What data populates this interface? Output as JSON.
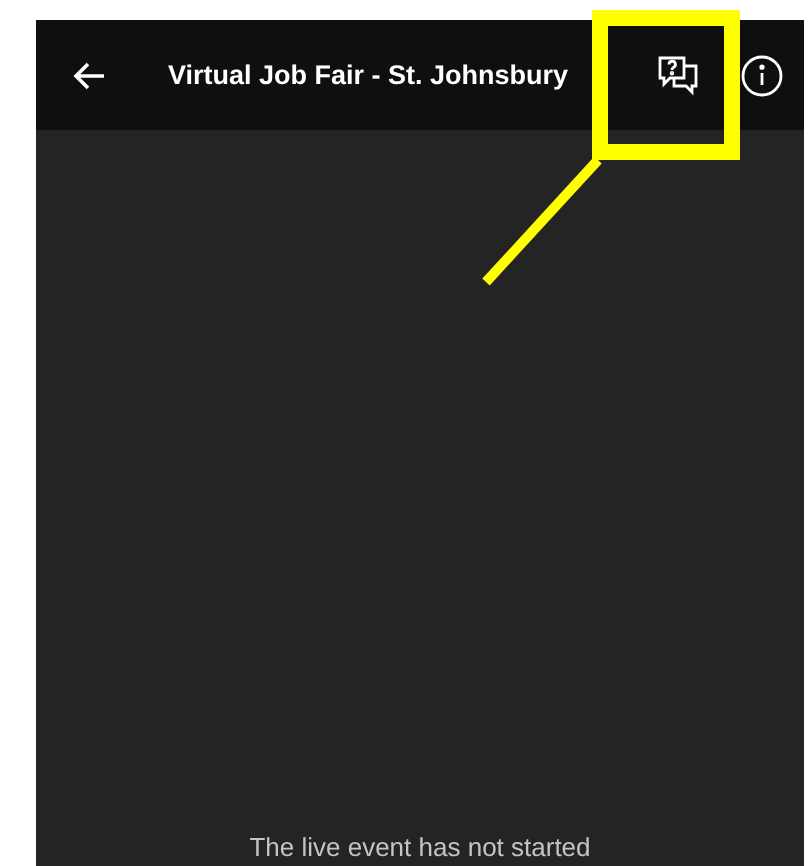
{
  "header": {
    "title": "Virtual Job Fair - St. Johnsbury"
  },
  "status_message": "The live event has not started"
}
